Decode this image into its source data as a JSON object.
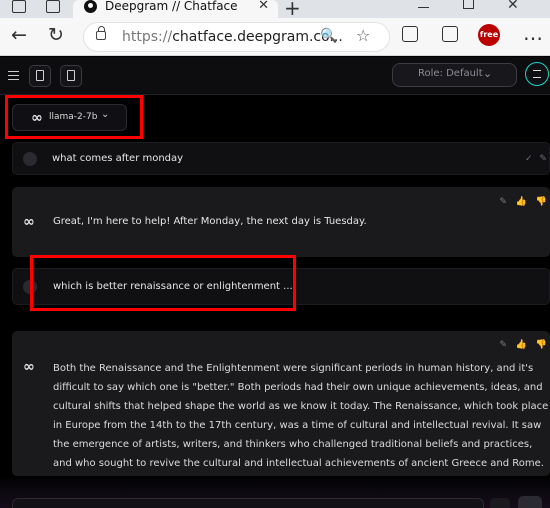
{
  "browser": {
    "tab_title": "Deepgram // Chatface",
    "tab_close": "✕",
    "new_tab": "+",
    "url_scheme": "https://",
    "url_host": "chatface.deepgram.co...",
    "avatar_text": "free"
  },
  "header": {
    "role_label": "Role: Default"
  },
  "model_selector": {
    "label": "llama-2-7b"
  },
  "conversation": {
    "messages": [
      {
        "role": "user",
        "text": "what comes after monday"
      },
      {
        "role": "assistant",
        "text": "Great, I'm here to help! After Monday, the next day is Tuesday."
      },
      {
        "role": "user",
        "text": "which is better renaissance or enlightenment ..."
      },
      {
        "role": "assistant",
        "text": "Both the Renaissance and the Enlightenment were significant periods in human history, and it's difficult to say which one is \"better.\" Both periods had their own unique achievements, ideas, and cultural shifts that helped shape the world as we know it today. The Renaissance, which took place in Europe from the 14th to the 17th century, was a time of cultural and intellectual revival. It saw the emergence of artists, writers, and thinkers who challenged traditional beliefs and practices, and who sought to revive the cultural and intellectual achievements of ancient Greece and Rome. The Renaissance saw the development of new artistic and literary forms, such as perspective painting, sonnets, and the novel."
      }
    ]
  },
  "icons": {
    "meta_logo": "∞",
    "back": "←",
    "reload": "↻",
    "zoom": "🔍",
    "star": "☆",
    "more": "…",
    "chevron": "⌄",
    "check_edit": "✓ ✎",
    "ai_actions": "✎ 👍 👎"
  },
  "colors": {
    "accent": "#17d6c8",
    "annotation": "#ff0000",
    "background": "#000000"
  }
}
